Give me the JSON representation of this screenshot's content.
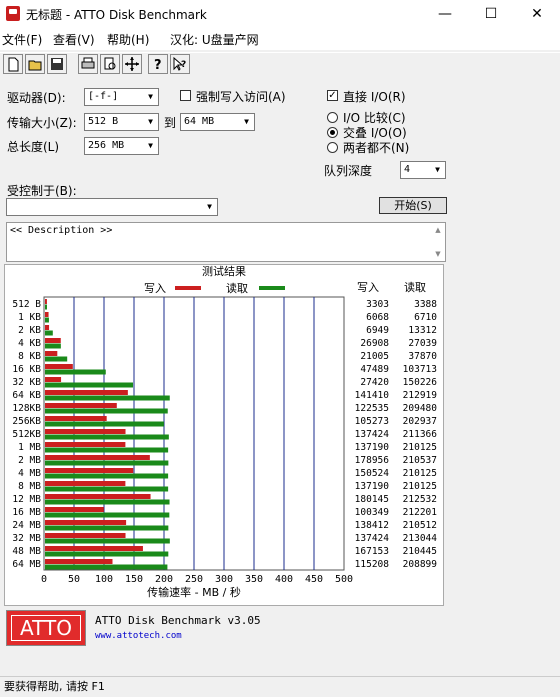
{
  "window": {
    "title": "无标题 - ATTO Disk Benchmark",
    "minimize": "—",
    "maximize": "☐",
    "close": "✕"
  },
  "menu": [
    "文件(F)",
    "查看(V)",
    "帮助(H)",
    "汉化: U盘量产网"
  ],
  "toolbar": [
    "new-icon",
    "open-icon",
    "save-icon",
    "print-icon",
    "print-preview-icon",
    "move-icon",
    "help-icon",
    "context-help-icon"
  ],
  "form": {
    "drive_label": "驱动器(D):",
    "drive_value": "[-f-]",
    "transfer_label": "传输大小(Z):",
    "transfer_from": "512 B",
    "transfer_to_label": "到",
    "transfer_to": "64 MB",
    "total_label": "总长度(L)",
    "total_value": "256 MB",
    "force_write_label": "强制写入访问(A)",
    "direct_io_label": "直接 I/O(R)",
    "radio_compare": "I/O 比较(C)",
    "radio_overlap": "交叠 I/O(O)",
    "radio_neither": "两者都不(N)",
    "queue_label": "队列深度",
    "queue_value": "4",
    "controlled_label": "受控制于(B):",
    "start_button": "开始(S)",
    "description": "<< Description >>"
  },
  "chart_data": {
    "type": "bar",
    "title": "测试结果",
    "legend_write": "写入",
    "legend_read": "读取",
    "write_color": "#cc1f1f",
    "read_color": "#1a8a1a",
    "col_write": "写入",
    "col_read": "读取",
    "categories": [
      "512 B",
      "1 KB",
      "2 KB",
      "4 KB",
      "8 KB",
      "16 KB",
      "32 KB",
      "64 KB",
      "128KB",
      "256KB",
      "512KB",
      "1 MB",
      "2 MB",
      "4 MB",
      "8 MB",
      "12 MB",
      "16 MB",
      "24 MB",
      "32 MB",
      "48 MB",
      "64 MB"
    ],
    "write": [
      3303,
      6068,
      6949,
      26908,
      21005,
      47489,
      27420,
      141410,
      122535,
      105273,
      137424,
      137190,
      178956,
      150524,
      137190,
      180145,
      100349,
      138412,
      137424,
      167153,
      115208
    ],
    "read": [
      3388,
      6710,
      13312,
      27039,
      37870,
      103713,
      150226,
      212919,
      209480,
      202937,
      211366,
      210125,
      210537,
      210125,
      210125,
      212532,
      212201,
      210512,
      213044,
      210445,
      208899
    ],
    "xticks": [
      "0",
      "50",
      "100",
      "150",
      "200",
      "250",
      "300",
      "350",
      "400",
      "450",
      "500"
    ],
    "xlim": [
      0,
      500
    ],
    "xlabel": "传输速率 - MB / 秒"
  },
  "footer": {
    "logo": "ATTO",
    "product": "ATTO Disk Benchmark v3.05",
    "url": "www.attotech.com"
  },
  "status": "要获得帮助, 请按 F1"
}
